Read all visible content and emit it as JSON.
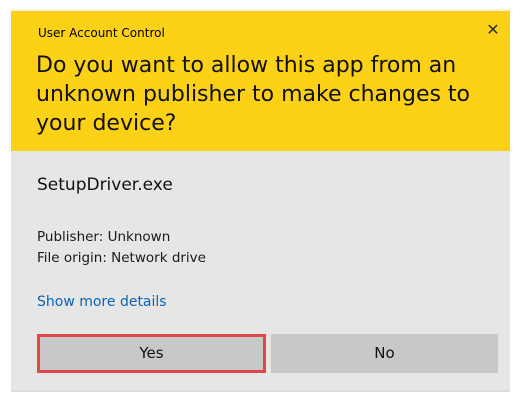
{
  "window": {
    "title": "User Account Control",
    "close_icon": "close-icon",
    "close_glyph": "✕"
  },
  "header": {
    "question": "Do you want to allow this app from an unknown publisher to make changes to your device?",
    "background_color": "#fcd116"
  },
  "app": {
    "name": "SetupDriver.exe",
    "publisher": "Publisher: Unknown",
    "file_origin": "File origin: Network drive"
  },
  "details_link": "Show more details",
  "buttons": {
    "yes_label": "Yes",
    "no_label": "No",
    "highlight_color": "#e0474b"
  }
}
